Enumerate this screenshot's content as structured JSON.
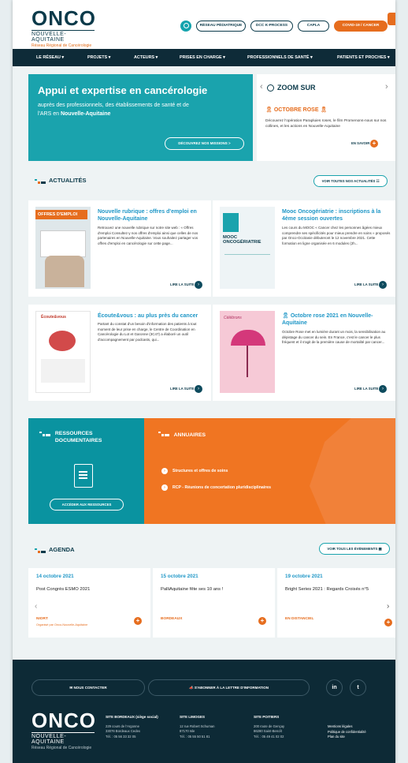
{
  "brand": {
    "name": "ONCO",
    "subtitle": "NOUVELLE-AQUITAINE",
    "tagline": "Réseau Régional de Cancérologie"
  },
  "colors": {
    "teal": "#1aa3ad",
    "navy": "#0e2b38",
    "orange": "#e66d1e",
    "blue": "#1f97c7"
  },
  "header": {
    "search_icon": "search-icon",
    "pills": [
      "RÉSEAU PÉDIATRIQUE",
      "DCC K-PROCESS",
      "CAPLA",
      "COVID-19 / CANCER"
    ]
  },
  "nav": {
    "items": [
      "LE RÉSEAU",
      "PROJETS",
      "ACTEURS",
      "PRISES EN CHARGE",
      "PROFESSIONNELS DE SANTÉ",
      "PATIENTS ET PROCHES"
    ]
  },
  "hero": {
    "title": "Appui et expertise en cancérologie",
    "subtitle_pre": "auprès des professionnels, des établissements de santé et de l'ARS en ",
    "subtitle_bold": "Nouvelle-Aquitaine",
    "button": "DÉCOUVREZ NOS MISSIONS  >"
  },
  "zoom": {
    "title": "ZOOM SUR",
    "subtitle": "OCTOBRE ROSE",
    "text": "Découvrez l'opération Parapluies roses, le film Promenons-nous sur nos collines, et les actions en Nouvelle-Aquitaine",
    "more": "EN SAVOIR"
  },
  "news": {
    "heading": "ACTUALITÉS",
    "all_button": "VOIR TOUTES NOS ACTUALITÉS",
    "read_more": "LIRE LA SUITE",
    "items": [
      {
        "title": "Nouvelle rubrique : offres d'emploi en Nouvelle-Aquitaine",
        "text": "Retrouvez une nouvelle rubrique sur notre site web : « Offres d'emploi Consultez-y nos offres d'emploi ainsi que celles de nos partenaires en Nouvelle-Aquitaine. Vous souhaitez partager vos offres d'emploi en cancérologie sur cette page...",
        "thumb_label": "OFFRES D'EMPLOI"
      },
      {
        "title": "Mooc Oncogériatrie : inscriptions à la 4ème session ouvertes",
        "text": "Les cours du MOOC « Cancer chez les personnes âgées mieux comprendre ses spécificités pour mieux prendre en soins » proposés par Onco-Occitanie débuteront le 12 novembre 2021. Cette formation en ligne organisée en 6 modules (2h...",
        "thumb_label": "MOOC ONCOGÉRIATRIE"
      },
      {
        "title": "Écoute&vous : au plus près du cancer",
        "text": "Partant du constat d'un besoin d'information des patients à tout moment de leur prise en charge, le Centre de Coordination en Cancérologie du Lot et Garonne (3C47) a élaboré un outil d'accompagnement par podcasts, qui...",
        "thumb_label": "Écoute&vous"
      },
      {
        "title": "Octobre rose 2021 en Nouvelle-Aquitaine",
        "text": "Octobre Rose met en lumière durant un mois, la sensibilisation au dépistage du cancer du sein. En France, c'est le cancer le plus fréquent et il s'agit de la première cause de mortalité par cancer...",
        "thumb_label": "Célébrons"
      }
    ]
  },
  "resources": {
    "heading": "RESSOURCES DOCUMENTAIRES",
    "button": "ACCÉDER AUX RESSOURCES"
  },
  "directories": {
    "heading": "ANNUAIRES",
    "items": [
      "Structures et offres de soins",
      "RCP - Réunions de concertation pluridisciplinaires"
    ]
  },
  "agenda": {
    "heading": "AGENDA",
    "all_button": "VOIR TOUS LES ÉVÉNEMENTS",
    "events": [
      {
        "date": "14 octobre 2021",
        "title": "Post Congrès ESMO 2021",
        "location": "NIORT",
        "organizer": "Organisé par Onco-Nouvelle-Aquitaine"
      },
      {
        "date": "15 octobre 2021",
        "title": "PalliAquitaine fête ses 10 ans !",
        "location": "BORDEAUX",
        "organizer": ""
      },
      {
        "date": "19 octobre 2021",
        "title": "Bright Series 2021 : Regards Croisés n°5",
        "location": "EN DISTANCIEL",
        "organizer": ""
      }
    ]
  },
  "footer": {
    "contact": "NOUS CONTACTER",
    "newsletter": "S'ABONNER À LA LETTRE D'INFORMATION",
    "social": [
      "in",
      "t"
    ],
    "sites": [
      {
        "name": "SITE BORDEAUX (siège social)",
        "lines": [
          "229 cours de l'Argonne",
          "33076 Bordeaux Cedex",
          "Tél. : 05 56 33 32 05"
        ]
      },
      {
        "name": "SITE LIMOGES",
        "lines": [
          "12 rue Robert Schuman",
          "87170 Isle",
          "Tél. : 05 55 50 51 81"
        ]
      },
      {
        "name": "SITE POITIERS",
        "lines": [
          "200 route de Gençay",
          "86280 Saint-Benoît",
          "Tél. : 05 49 41 02 02"
        ]
      }
    ],
    "legal": [
      "Mentions légales",
      "Politique de confidentialité",
      "Plan du site"
    ]
  }
}
